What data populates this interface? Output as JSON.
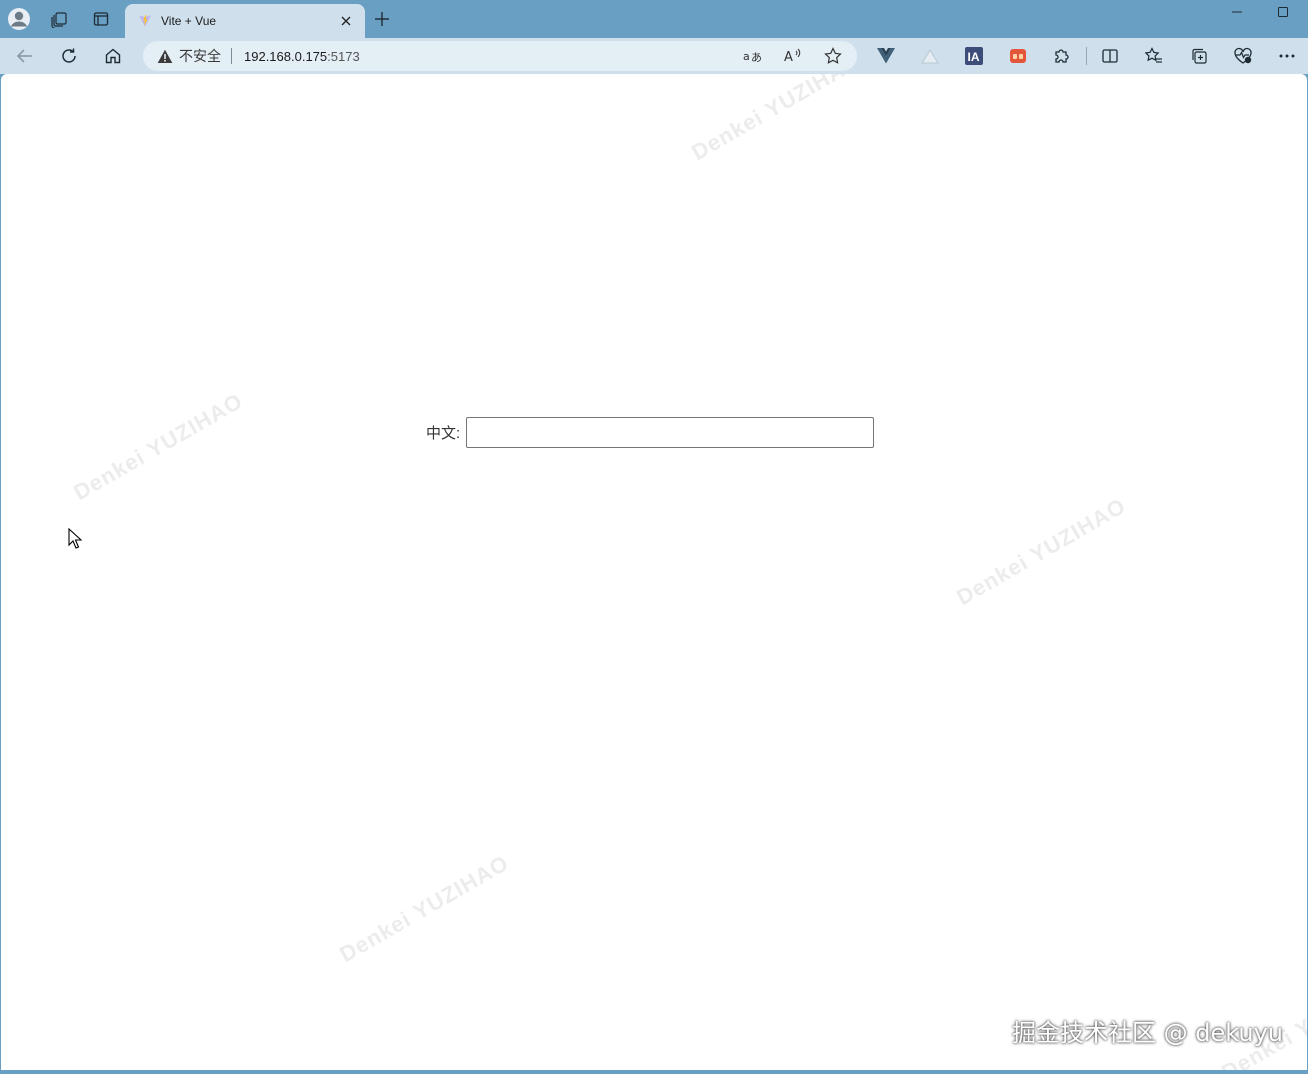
{
  "tabs": [
    {
      "title": "Vite + Vue",
      "active": true
    }
  ],
  "address_bar": {
    "security_label": "不安全",
    "url_host": "192.168.0.175",
    "url_port": ":5173"
  },
  "page": {
    "field_label": "中文:",
    "field_value": ""
  },
  "watermark": {
    "text": "Denkei YUZIHAO"
  },
  "credit": "掘金技术社区 @ dekuyu",
  "colors": {
    "frame": "#6a9fc4",
    "toolbar": "#cfe0ec",
    "omnibox": "#e4eef5"
  },
  "icons": {
    "profile": "avatar-icon",
    "workspaces": "workspaces-icon",
    "tab_actions": "tab-actions-icon",
    "back": "back-arrow-icon",
    "refresh": "refresh-icon",
    "home": "home-icon",
    "warning": "warning-icon",
    "translate": "translate-icon",
    "read_aloud": "read-aloud-icon",
    "favorite": "star-icon",
    "extensions": "puzzle-icon",
    "split": "split-screen-icon",
    "favorites": "favorites-icon",
    "collections": "collections-icon",
    "performance": "heart-pulse-icon",
    "menu": "ellipsis-icon"
  }
}
